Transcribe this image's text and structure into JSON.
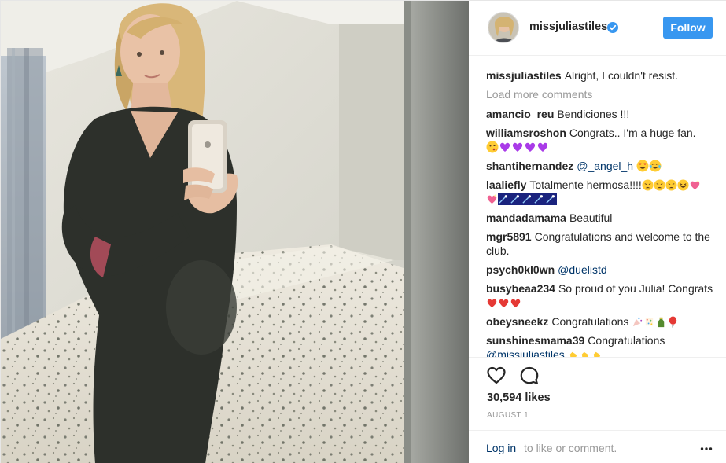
{
  "post": {
    "username": "missjuliastiles",
    "follow_label": "Follow",
    "verified_icon": "verified-badge-icon",
    "caption": {
      "username": "missjuliastiles",
      "text": "Alright, I couldn't resist."
    },
    "load_more_label": "Load more comments",
    "comments": [
      {
        "user": "amancio_reu",
        "text": "Bendiciones !!!"
      },
      {
        "user": "williamsroshon",
        "text": "Congrats.. I'm a huge fan.",
        "emoji": [
          "blowing-kiss",
          "purple-heart",
          "purple-heart",
          "purple-heart",
          "purple-heart"
        ]
      },
      {
        "user": "shantihernandez",
        "mention": "@_angel_h",
        "emoji": [
          "heart-eyes",
          "laugh-cry"
        ]
      },
      {
        "user": "laaliefly",
        "text": "Totalmente hermosa!!!!",
        "emoji": [
          "weary-face",
          "weary-face",
          "weary-face",
          "laughing",
          "heart-sparkle",
          "heart-sparkle",
          "shooting-star",
          "shooting-star",
          "shooting-star",
          "shooting-star",
          "shooting-star"
        ]
      },
      {
        "user": "mandadamama",
        "text": "Beautiful"
      },
      {
        "user": "mgr5891",
        "text": "Congratulations and welcome to the club."
      },
      {
        "user": "psych0kl0wn",
        "mention": "@duelistd"
      },
      {
        "user": "busybeaa234",
        "text": "So proud of you Julia! Congrats",
        "emoji": [
          "red-heart",
          "red-heart",
          "red-heart"
        ]
      },
      {
        "user": "obeysneekz",
        "text": "Congratulations",
        "emoji": [
          "party-popper",
          "confetti",
          "bottle",
          "balloon"
        ]
      },
      {
        "user": "sunshinesmama39",
        "text": "Congratulations",
        "mention": "@missjuliastiles",
        "emoji": [
          "clap",
          "clap",
          "clap"
        ]
      }
    ],
    "likes_label": "30,594 likes",
    "date_label": "AUGUST 1",
    "login_link": "Log in",
    "login_suffix": "to like or comment.",
    "icons": {
      "like": "heart-icon",
      "comment": "comment-bubble-icon",
      "more": "more-options-icon"
    },
    "colors": {
      "follow_bg": "#3897f0",
      "link": "#003569",
      "muted": "#999999",
      "text": "#262626"
    }
  }
}
